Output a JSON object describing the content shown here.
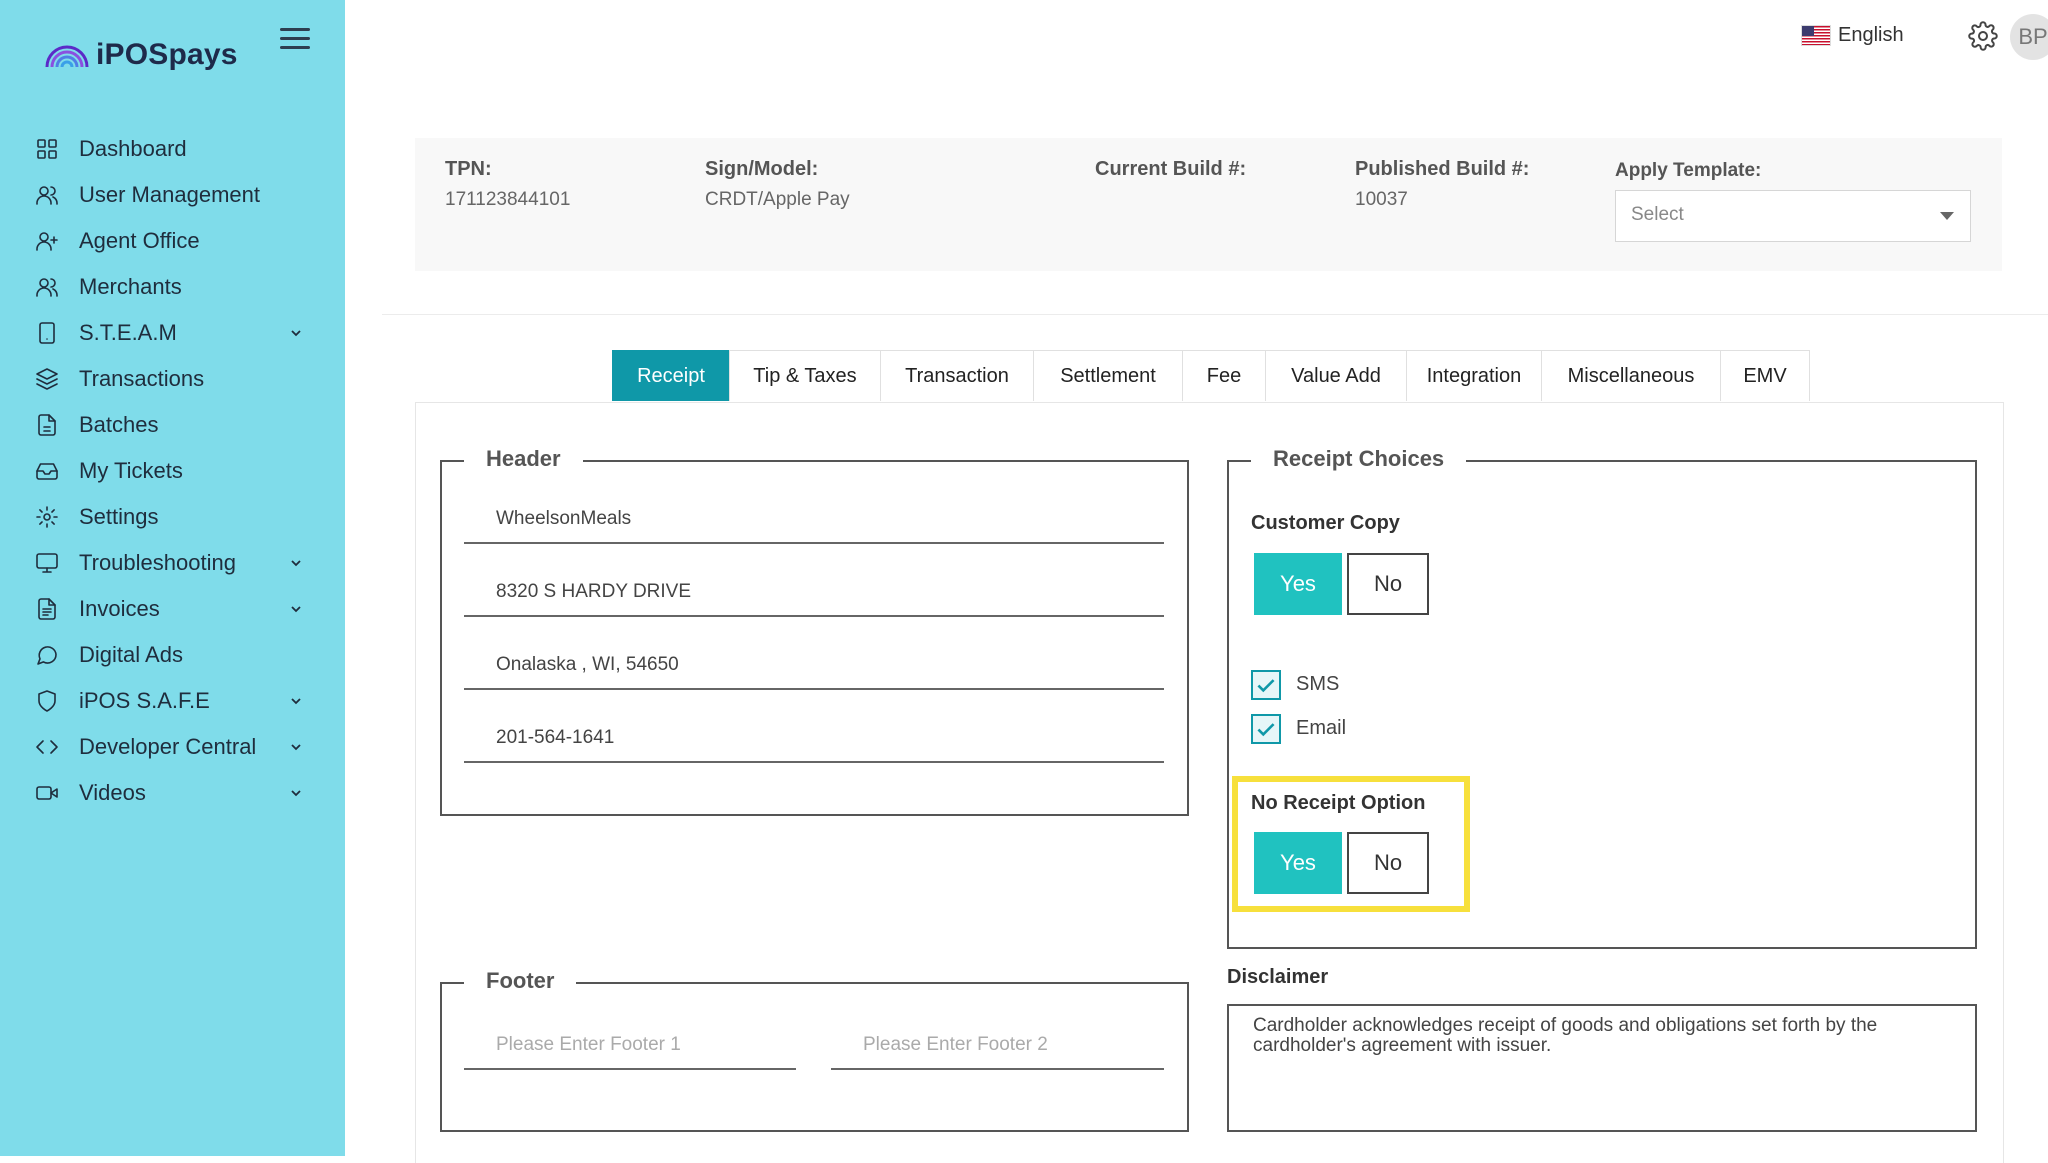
{
  "app": {
    "name": "iPOSpays"
  },
  "colors": {
    "sidebar": "#7fdcea",
    "accent": "#0f98a8",
    "yes_button": "#20c2c0",
    "highlight": "#f7e03c"
  },
  "sidebar": {
    "items": [
      {
        "label": "Dashboard",
        "icon": "dashboard-icon"
      },
      {
        "label": "User Management",
        "icon": "users-icon"
      },
      {
        "label": "Agent Office",
        "icon": "user-plus-icon"
      },
      {
        "label": "Merchants",
        "icon": "merchants-icon"
      },
      {
        "label": "S.T.E.A.M",
        "icon": "tablet-icon",
        "expandable": true
      },
      {
        "label": "Transactions",
        "icon": "layers-icon"
      },
      {
        "label": "Batches",
        "icon": "file-icon"
      },
      {
        "label": "My Tickets",
        "icon": "inbox-icon"
      },
      {
        "label": "Settings",
        "icon": "gear-icon"
      },
      {
        "label": "Troubleshooting",
        "icon": "monitor-icon",
        "expandable": true
      },
      {
        "label": "Invoices",
        "icon": "invoice-icon",
        "expandable": true
      },
      {
        "label": "Digital Ads",
        "icon": "message-icon"
      },
      {
        "label": "iPOS S.A.F.E",
        "icon": "shield-icon",
        "expandable": true
      },
      {
        "label": "Developer Central",
        "icon": "code-icon",
        "expandable": true
      },
      {
        "label": "Videos",
        "icon": "video-icon",
        "expandable": true
      }
    ]
  },
  "topbar": {
    "language": "English",
    "avatar": "BP"
  },
  "info": {
    "tpn_label": "TPN:",
    "tpn_value": "171123844101",
    "sign_label": "Sign/Model:",
    "sign_value": "CRDT/Apple Pay",
    "current_build_label": "Current Build #:",
    "current_build_value": "",
    "published_build_label": "Published Build #:",
    "published_build_value": "10037",
    "apply_template_label": "Apply Template:",
    "apply_template_placeholder": "Select"
  },
  "tabs": [
    "Receipt",
    "Tip & Taxes",
    "Transaction",
    "Settlement",
    "Fee",
    "Value Add",
    "Integration",
    "Miscellaneous",
    "EMV"
  ],
  "active_tab": "Receipt",
  "header_section": {
    "legend": "Header",
    "lines": [
      "WheelsonMeals",
      "8320 S HARDY DRIVE",
      "Onalaska , WI, 54650",
      "201-564-1641"
    ]
  },
  "footer_section": {
    "legend": "Footer",
    "footer1_placeholder": "Please Enter Footer 1",
    "footer2_placeholder": "Please Enter Footer 2"
  },
  "receipt_choices": {
    "legend": "Receipt Choices",
    "customer_copy_label": "Customer Copy",
    "yes": "Yes",
    "no": "No",
    "customer_copy_selected": "Yes",
    "sms_label": "SMS",
    "sms_checked": true,
    "email_label": "Email",
    "email_checked": true,
    "no_receipt_label": "No Receipt Option",
    "no_receipt_selected": "Yes"
  },
  "disclaimer": {
    "label": "Disclaimer",
    "text": "Cardholder acknowledges receipt of goods and obligations set forth by the cardholder's agreement with issuer."
  }
}
